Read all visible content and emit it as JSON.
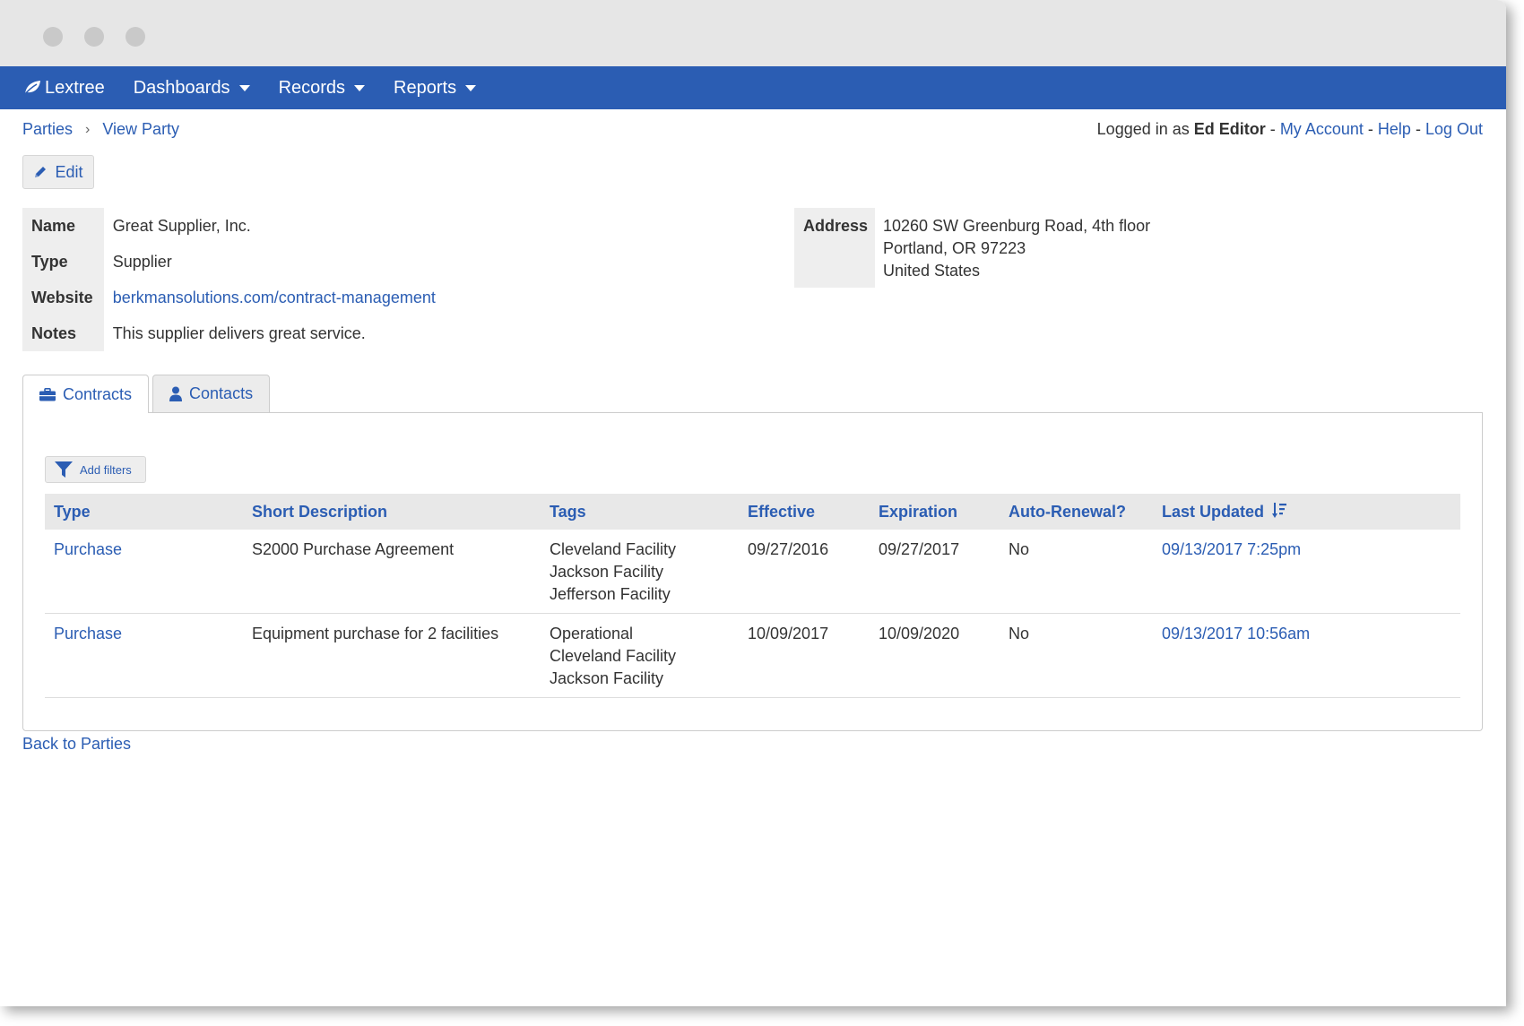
{
  "window": {
    "controls": [
      "close",
      "minimize",
      "maximize"
    ]
  },
  "nav": {
    "brand": "Lextree",
    "brand_icon": "leaf-icon",
    "menus": [
      {
        "label": "Dashboards"
      },
      {
        "label": "Records"
      },
      {
        "label": "Reports"
      }
    ]
  },
  "breadcrumb": {
    "parent": "Parties",
    "current": "View Party"
  },
  "account": {
    "prefix": "Logged in as",
    "user": "Ed Editor",
    "links": [
      "My Account",
      "Help",
      "Log Out"
    ],
    "separator": "-"
  },
  "toolbar": {
    "edit_label": "Edit"
  },
  "party": {
    "fields": [
      {
        "label": "Name",
        "value": "Great Supplier, Inc."
      },
      {
        "label": "Type",
        "value": "Supplier"
      },
      {
        "label": "Website",
        "value": "berkmansolutions.com/contract-management"
      },
      {
        "label": "Notes",
        "value": "This supplier delivers great service."
      }
    ],
    "address_label": "Address",
    "address_lines": [
      "10260 SW Greenburg Road, 4th floor",
      "Portland, OR 97223",
      "United States"
    ]
  },
  "tabs": [
    {
      "label": "Contracts",
      "icon": "briefcase-icon",
      "active": true
    },
    {
      "label": "Contacts",
      "icon": "user-icon",
      "active": false
    }
  ],
  "filters": {
    "label": "Add filters"
  },
  "contracts": {
    "columns": [
      "Type",
      "Short Description",
      "Tags",
      "Effective",
      "Expiration",
      "Auto-Renewal?",
      "Last Updated"
    ],
    "sort_icon": "sort-desc-icon",
    "rows": [
      {
        "type": "Purchase",
        "description": "S2000 Purchase Agreement",
        "tags": [
          "Cleveland Facility",
          "Jackson Facility",
          "Jefferson Facility"
        ],
        "effective": "09/27/2016",
        "expiration": "09/27/2017",
        "auto_renewal": "No",
        "last_updated": "09/13/2017 7:25pm"
      },
      {
        "type": "Purchase",
        "description": "Equipment purchase for 2 facilities",
        "tags": [
          "Operational",
          "Cleveland Facility",
          "Jackson Facility"
        ],
        "effective": "10/09/2017",
        "expiration": "10/09/2020",
        "auto_renewal": "No",
        "last_updated": "09/13/2017 10:56am"
      }
    ]
  },
  "footer": {
    "back_label": "Back to Parties"
  },
  "colors": {
    "brand": "#2b5db3",
    "header_bg": "#eeeeee",
    "titlebar": "#e6e6e6"
  }
}
